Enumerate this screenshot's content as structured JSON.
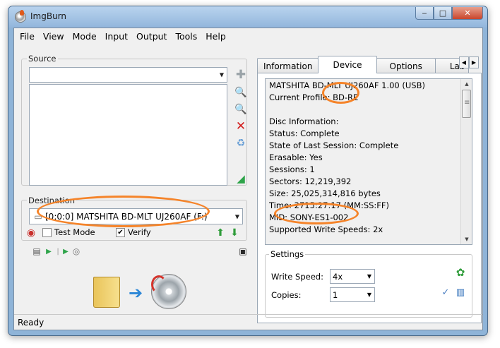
{
  "window": {
    "title": "ImgBurn"
  },
  "menu": [
    "File",
    "View",
    "Mode",
    "Input",
    "Output",
    "Tools",
    "Help"
  ],
  "source": {
    "label": "Source",
    "value": ""
  },
  "destination": {
    "label": "Destination",
    "value": "[0:0:0] MATSHITA BD-MLT UJ260AF (F:)",
    "test_mode_label": "Test Mode",
    "verify_label": "Verify",
    "test_mode_checked": false,
    "verify_checked": true
  },
  "tabs": [
    "Information",
    "Device",
    "Options",
    "Lab"
  ],
  "active_tab": "Device",
  "device_info": [
    "MATSHITA BD-MLT UJ260AF 1.00 (USB)",
    "Current Profile: BD-RE",
    "",
    "Disc Information:",
    "Status: Complete",
    "State of Last Session: Complete",
    "Erasable: Yes",
    "Sessions: 1",
    "Sectors: 12,219,392",
    "Size: 25,025,314,816 bytes",
    "Time: 2715:27:17 (MM:SS:FF)",
    "MID: SONY-ES1-002",
    "Supported Write Speeds: 2x"
  ],
  "settings": {
    "label": "Settings",
    "write_speed_label": "Write Speed:",
    "write_speed_value": "4x",
    "copies_label": "Copies:",
    "copies_value": "1"
  },
  "status": {
    "text": "Ready"
  },
  "colors": {
    "annotation": "#f5842a",
    "titlebar": "#b9d3ee"
  }
}
